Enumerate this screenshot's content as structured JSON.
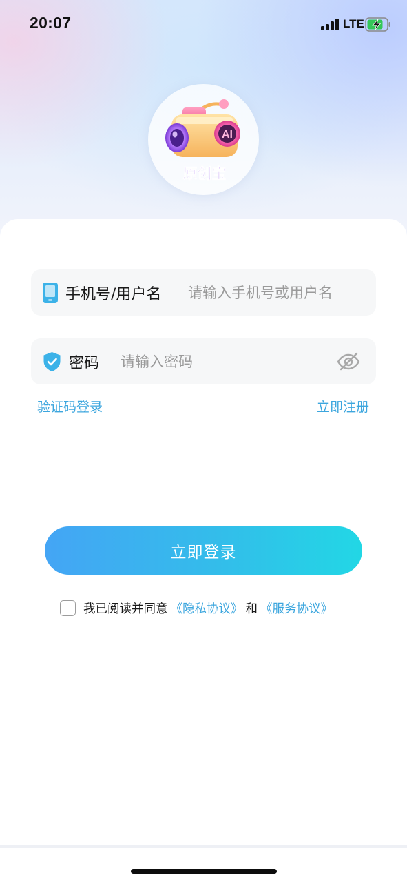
{
  "status_bar": {
    "time": "20:07",
    "network": "LTE",
    "battery_state": "charging",
    "battery_level": 0.75,
    "signal_bars": 4
  },
  "logo": {
    "brand_text": "原创宝",
    "badge_text": "AI"
  },
  "form": {
    "phone": {
      "label": "手机号/用户名",
      "placeholder": "请输入手机号或用户名",
      "value": "",
      "icon": "phone-icon"
    },
    "password": {
      "label": "密码",
      "placeholder": "请输入密码",
      "value": "",
      "icon": "shield-check-icon",
      "toggle_icon": "eye-off-icon"
    }
  },
  "links": {
    "sms_login": "验证码登录",
    "register": "立即注册"
  },
  "login_button": "立即登录",
  "agreement": {
    "checked": false,
    "prefix": "我已阅读并同意",
    "privacy": "《隐私协议》",
    "and": "和",
    "service": "《服务协议》"
  },
  "colors": {
    "accent": "#3ca6de",
    "button_start": "#44a5f5",
    "button_end": "#22d7e5",
    "field_bg": "#f6f7f8"
  }
}
